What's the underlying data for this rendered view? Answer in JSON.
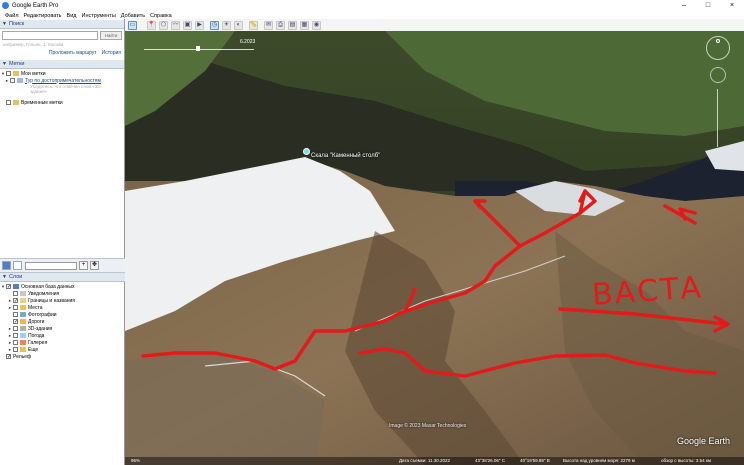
{
  "window": {
    "title": "Google Earth Pro"
  },
  "menu": [
    "Файл",
    "Редактировать",
    "Вид",
    "Инструменты",
    "Добавить",
    "Справка"
  ],
  "toolbar": {
    "icons": [
      "sidebar-toggle",
      "placemark",
      "polygon",
      "path",
      "image-overlay",
      "tour",
      "historical-imagery",
      "sun",
      "planets",
      "ruler",
      "email",
      "print",
      "save-image",
      "maps",
      "kml"
    ],
    "active": [
      "sidebar-toggle",
      "historical-imagery"
    ]
  },
  "search": {
    "header": "Поиск",
    "placeholder": "",
    "button_label": "Найти",
    "hint": "например, Гольян, 1, Москва",
    "link_route": "Проложить маршрут",
    "link_history": "История"
  },
  "places": {
    "header": "Метки",
    "items": [
      {
        "label": "Мои метки"
      },
      {
        "label": "Тур по достопримечательностям",
        "sub": "Убедитесь, что отмечен слой «3D-здания»"
      },
      {
        "label": "Временные метки"
      }
    ]
  },
  "layers": {
    "header": "Слои",
    "items": [
      {
        "label": "Основная база данных",
        "checked": true
      },
      {
        "label": "Уведомления",
        "checked": false
      },
      {
        "label": "Границы и названия",
        "checked": true
      },
      {
        "label": "Места",
        "checked": false
      },
      {
        "label": "Фотографии",
        "checked": false
      },
      {
        "label": "Дороги",
        "checked": true
      },
      {
        "label": "3D-здания",
        "checked": false
      },
      {
        "label": "Погода",
        "checked": false
      },
      {
        "label": "Галерея",
        "checked": false
      },
      {
        "label": "Еще",
        "checked": false
      },
      {
        "label": "Рельеф",
        "checked": true
      }
    ]
  },
  "map": {
    "time_slider_date": "6.2023",
    "place_label": "Скала \"Каменный столб\"",
    "annotation_text": "ВАСТА",
    "copyright": "Image © 2023 Maxar Technologies",
    "logo": "Google Earth"
  },
  "status": {
    "zoom": "96%",
    "date": "Дата съемки: 11.30.2022",
    "lat": "43°38'26.06\" С",
    "lon": "40°19'59.89\" В",
    "elevation": "Высота над уровнем моря: 2279 м",
    "eye_alt": "обзор с высоты: 3.54 км"
  },
  "colors": {
    "annotation": "#e31a1a",
    "link": "#1c48a0",
    "panel_header": "#dfe7ef"
  }
}
